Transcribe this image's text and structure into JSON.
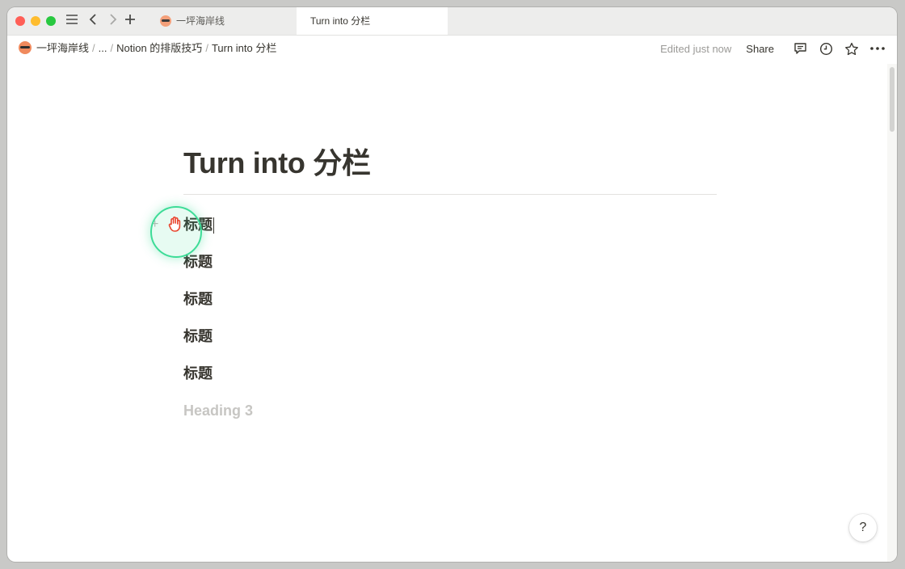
{
  "tabs": [
    {
      "label": "一坪海岸线",
      "active": false
    },
    {
      "label": "Turn into 分栏",
      "active": true
    }
  ],
  "titlebar_icons": [
    "sidebar-menu-icon",
    "back-arrow-icon",
    "forward-arrow-icon",
    "new-tab-plus-icon"
  ],
  "breadcrumb": {
    "workspace": "一坪海岸线",
    "ellipsis": "...",
    "parent": "Notion 的排版技巧",
    "current": "Turn into 分栏",
    "separator": "/"
  },
  "topbar": {
    "edited": "Edited just now",
    "share": "Share",
    "icons": [
      "comment-icon",
      "history-clock-icon",
      "favorite-star-icon",
      "more-dots-icon"
    ]
  },
  "page": {
    "title": "Turn into 分栏",
    "blocks": [
      "标题",
      "标题",
      "标题",
      "标题",
      "标题"
    ],
    "placeholder_block": "Heading 3"
  },
  "help_button": "?",
  "colors": {
    "text": "#37352f",
    "muted": "#9b9a97",
    "cursor_highlight": "#3ddc97"
  }
}
